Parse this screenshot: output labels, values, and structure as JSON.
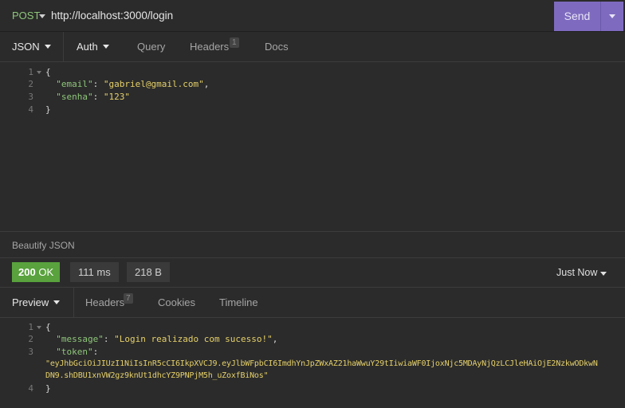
{
  "request": {
    "method": "POST",
    "url": "http://localhost:3000/login",
    "send_label": "Send"
  },
  "request_tabs": {
    "body": "JSON",
    "auth": "Auth",
    "query": "Query",
    "headers": "Headers",
    "headers_count": "1",
    "docs": "Docs"
  },
  "request_body": {
    "line_numbers": [
      "1",
      "2",
      "3",
      "4"
    ],
    "open_brace": "{",
    "key_email": "\"email\"",
    "value_email": "\"gabriel@gmail.com\"",
    "key_senha": "\"senha\"",
    "value_senha": "\"123\"",
    "close_brace": "}"
  },
  "beautify_label": "Beautify JSON",
  "response_status": {
    "code": "200",
    "text": "OK",
    "color": "#59a23d",
    "time": "111 ms",
    "size": "218 B",
    "timestamp": "Just Now"
  },
  "response_tabs": {
    "preview": "Preview",
    "headers": "Headers",
    "headers_count": "7",
    "cookies": "Cookies",
    "timeline": "Timeline"
  },
  "response_body": {
    "line_numbers": [
      "1",
      "2",
      "3",
      "4"
    ],
    "open_brace": "{",
    "key_message": "\"message\"",
    "value_message": "\"Login realizado com sucesso!\"",
    "key_token": "\"token\"",
    "value_token_line1": "\"eyJhbGciOiJIUzI1NiIsInR5cCI6IkpXVCJ9.eyJlbWFpbCI6ImdhYnJpZWxAZ21haWwuY29tIiwiaWF0IjoxNjc5MDAyNjQzLCJleHAiOjE2NzkwODkwN",
    "value_token_line2": "DN9.shDBU1xnVW2gz9knUt1dhcYZ9PNPjM5h_uZoxfBiNos\"",
    "close_brace": "}"
  },
  "colors": {
    "accent": "#7e6bbf",
    "json_key": "#8ec67a",
    "json_string": "#e5d06a",
    "background": "#2b2b2b"
  }
}
